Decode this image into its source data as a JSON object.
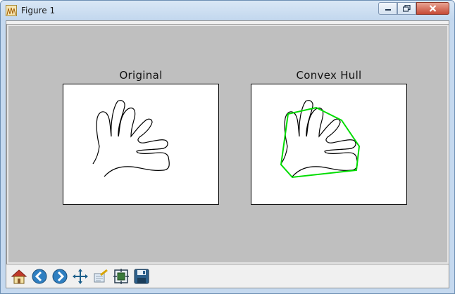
{
  "window": {
    "title": "Figure 1",
    "controls": {
      "minimize": "minimize-icon",
      "maximize": "maximize-icon",
      "close": "close-icon"
    }
  },
  "figure": {
    "axes": [
      {
        "title": "Original"
      },
      {
        "title": "Convex Hull",
        "hull_color": "#00dd00"
      }
    ]
  },
  "toolbar": {
    "buttons": [
      {
        "icon": "home-icon",
        "name": "home"
      },
      {
        "icon": "back-icon",
        "name": "back"
      },
      {
        "icon": "forward-icon",
        "name": "forward"
      },
      {
        "icon": "pan-icon",
        "name": "pan"
      },
      {
        "icon": "zoom-icon",
        "name": "zoom"
      },
      {
        "icon": "subplots-icon",
        "name": "configure-subplots"
      },
      {
        "icon": "save-icon",
        "name": "save"
      }
    ]
  }
}
